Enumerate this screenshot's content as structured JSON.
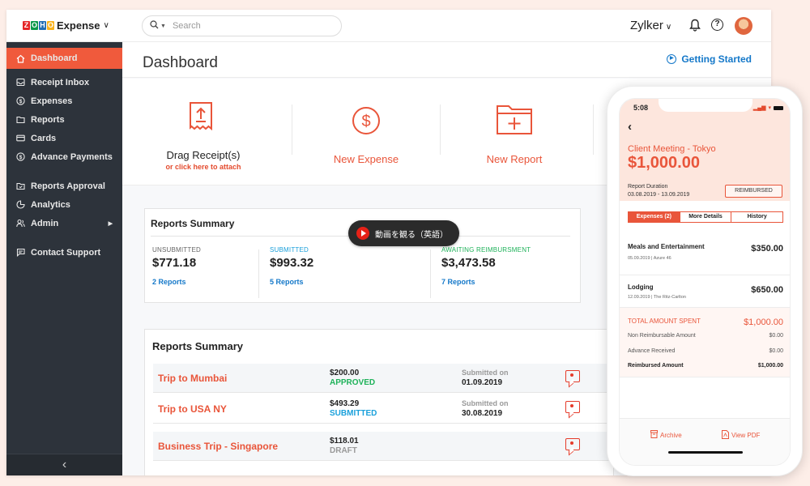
{
  "brand": {
    "zoho_letters": [
      "Z",
      "O",
      "H",
      "O"
    ],
    "zoho_colors": [
      "#e42527",
      "#089949",
      "#226db4",
      "#f9b21d"
    ],
    "app_name": "Expense"
  },
  "sidebar": {
    "items": [
      {
        "label": "Dashboard",
        "icon": "home-icon"
      },
      {
        "label": "Receipt Inbox",
        "icon": "inbox-icon"
      },
      {
        "label": "Expenses",
        "icon": "dollar-icon"
      },
      {
        "label": "Reports",
        "icon": "folder-icon"
      },
      {
        "label": "Cards",
        "icon": "card-icon"
      },
      {
        "label": "Advance Payments",
        "icon": "advance-icon"
      },
      {
        "label": "Reports Approval",
        "icon": "approval-icon"
      },
      {
        "label": "Analytics",
        "icon": "analytics-icon"
      },
      {
        "label": "Admin",
        "icon": "users-icon"
      },
      {
        "label": "Contact Support",
        "icon": "chat-icon"
      }
    ],
    "collapse_icon": "‹"
  },
  "topbar": {
    "search_placeholder": "Search",
    "org_name": "Zylker"
  },
  "page": {
    "title": "Dashboard",
    "getting_started": "Getting Started"
  },
  "actions": {
    "drag_label": "Drag Receipt(s)",
    "drag_sub": "or click here to attach",
    "new_expense": "New Expense",
    "new_report": "New Report"
  },
  "summary1": {
    "title": "Reports Summary",
    "cols": [
      {
        "key": "UNSUBMITTED",
        "value": "$771.18",
        "link": "2 Reports",
        "color": "#666666"
      },
      {
        "key": "SUBMITTED",
        "value": "$993.32",
        "link": "5 Reports",
        "color": "#1aa0db"
      },
      {
        "key": "AWAITING REIMBURSMENT",
        "value": "$3,473.58",
        "link": "7 Reports",
        "color": "#1fb25a"
      }
    ]
  },
  "summary2": {
    "title": "Reports Summary",
    "rows": [
      {
        "name": "Trip to Mumbai",
        "amount": "$200.00",
        "status": "APPROVED",
        "status_color": "#1fb25a",
        "sub_label": "Submitted on",
        "date": "01.09.2019"
      },
      {
        "name": "Trip to USA NY",
        "amount": "$493.29",
        "status": "SUBMITTED",
        "status_color": "#1aa0db",
        "sub_label": "Submitted on",
        "date": "30.08.2019"
      },
      {
        "name": "Business Trip - Singapore",
        "amount": "$118.01",
        "status": "DRAFT",
        "status_color": "#999999",
        "sub_label": "",
        "date": ""
      }
    ]
  },
  "video": {
    "label": "動画を観る（英語）"
  },
  "phone": {
    "time": "5:08",
    "trip": "Client Meeting - Tokyo",
    "amount": "$1,000.00",
    "duration_label": "Report Duration",
    "duration": "03.08.2019 - 13.09.2019",
    "badge": "REIMBURSED",
    "tabs": [
      "Expenses (2)",
      "More Details",
      "History"
    ],
    "expenses": [
      {
        "name": "Meals and Entertainment",
        "meta": "05.09.2019  |  Azure 46",
        "amount": "$350.00"
      },
      {
        "name": "Lodging",
        "meta": "12.09.2019  |  The Ritz-Carlton",
        "amount": "$650.00"
      }
    ],
    "totals": [
      {
        "label": "TOTAL AMOUNT SPENT",
        "value": "$1,000.00"
      },
      {
        "label": "Non Reimbursable Amount",
        "value": "$0.00"
      },
      {
        "label": "Advance Received",
        "value": "$0.00"
      },
      {
        "label": "Reimbursed Amount",
        "value": "$1,000.00"
      }
    ],
    "archive": "Archive",
    "view_pdf": "View PDF"
  },
  "colors": {
    "accent": "#f05a3c",
    "sidebar_bg": "#2d333b",
    "link": "#1478c9"
  }
}
